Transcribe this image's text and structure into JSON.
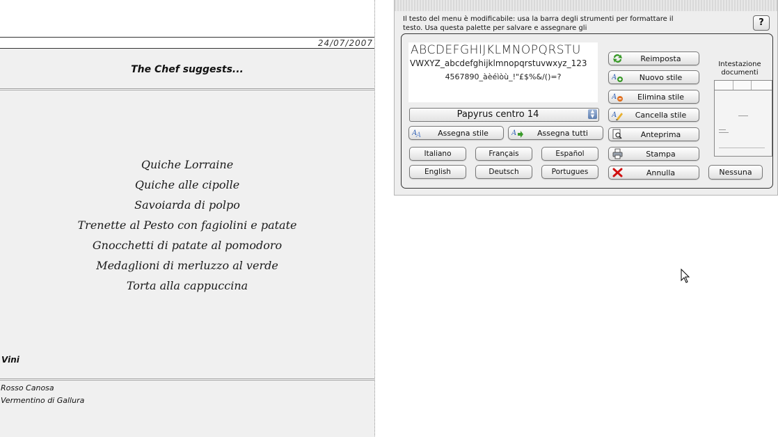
{
  "menu_document": {
    "date": "24/07/2007",
    "title": "The Chef suggests...",
    "dishes": [
      "Quiche Lorraine",
      "Quiche alle cipolle",
      "Savoiarda di polpo",
      "Trenette al Pesto con fagiolini e patate",
      "Gnocchetti di patate al pomodoro",
      "Medaglioni di merluzzo al verde",
      "Torta alla cappuccina"
    ],
    "wine_section_title": "Vini",
    "wines": [
      "Rosso Canosa",
      "Vermentino di Gallura"
    ]
  },
  "palette": {
    "hint": "Il testo del menu è modificabile: usa la barra degli strumenti per formattare il testo. Usa questa palette per salvare e assegnare gli",
    "help_label": "?",
    "font_preview": {
      "line1": "ABCDEFGHIJKLMNOPQRSTU",
      "line2": "VWXYZ_abcdefghijklmnopqrstuvwxyz_123",
      "line3": "4567890_àèéìòù_!\"£$%&/()=?"
    },
    "style_select": "Papyrus centro 14",
    "assign_style": "Assegna stile",
    "assign_all": "Assegna tutti",
    "languages": [
      "Italiano",
      "Français",
      "Español",
      "English",
      "Deutsch",
      "Portugues"
    ],
    "actions": {
      "reset": "Reimposta",
      "new_style": "Nuovo stile",
      "delete_style": "Elimina stile",
      "clear_style": "Cancella stile",
      "preview": "Anteprima",
      "print": "Stampa",
      "cancel": "Annulla"
    },
    "header_label": "Intestazione documenti",
    "none_button": "Nessuna"
  },
  "colors": {
    "panel_bg": "#eeeeee",
    "band_bg": "#f0f0f0",
    "cancel_icon": "#d01010",
    "reset_icon": "#3a9a2a"
  },
  "icons": {
    "reset": "refresh-arrows-icon",
    "new_style": "new-style-icon",
    "delete_style": "delete-style-icon",
    "clear_style": "pencil-eraser-icon",
    "preview": "magnifier-page-icon",
    "print": "printer-icon",
    "cancel": "red-x-icon",
    "assign": "font-assign-icon"
  }
}
